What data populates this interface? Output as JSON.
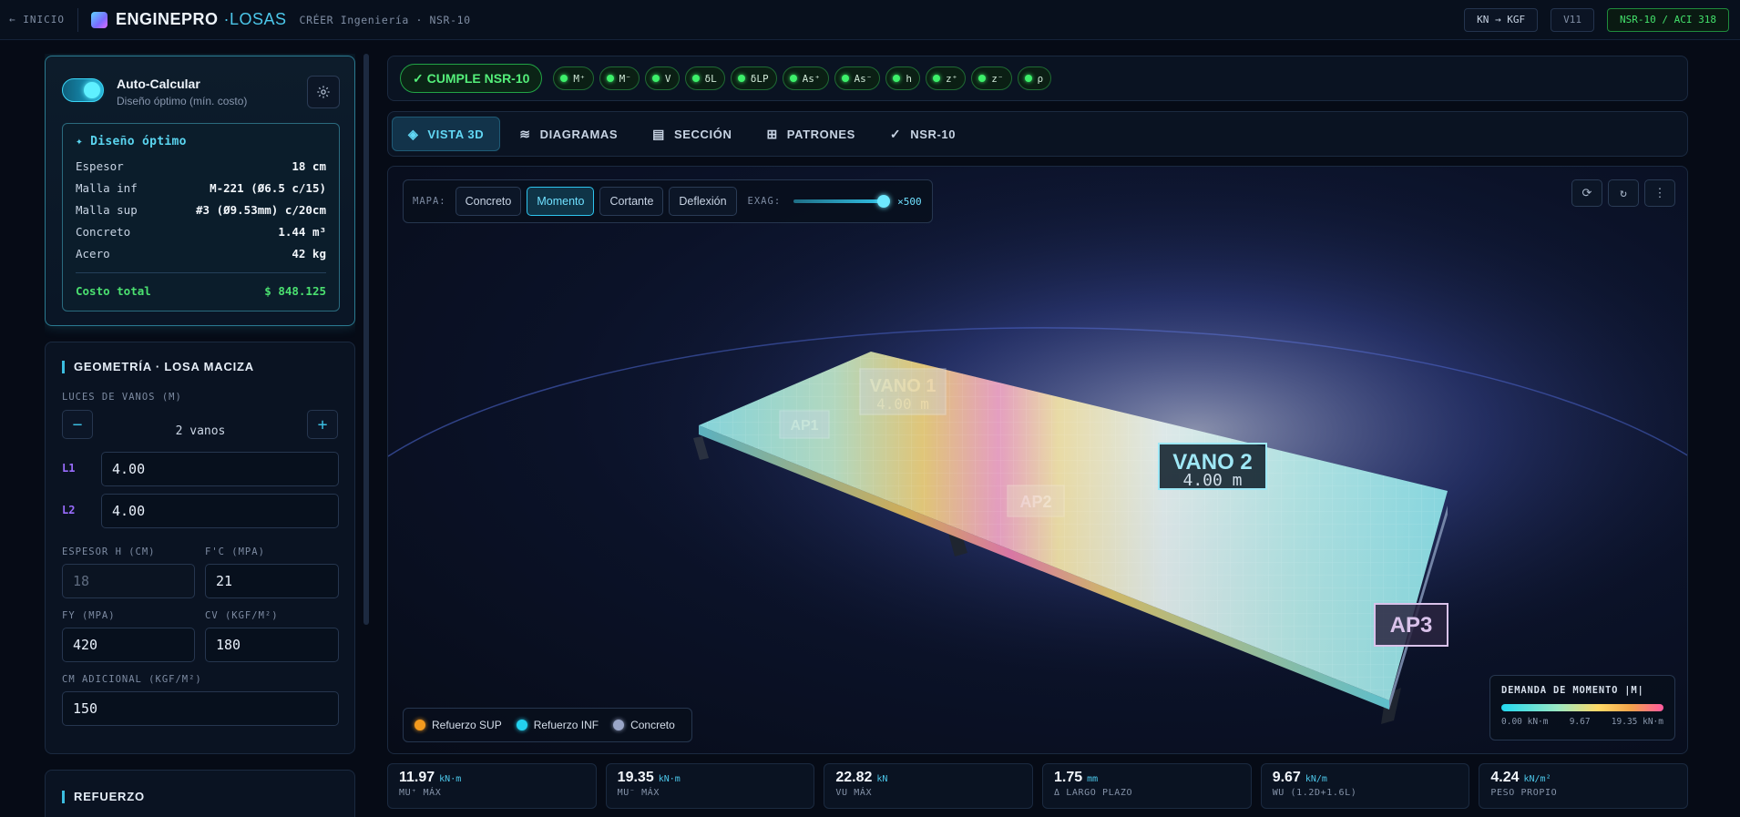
{
  "topbar": {
    "back_label": "← INICIO",
    "brand": "ENGINEPRO",
    "brand_accent": "·LOSAS",
    "subtitle": "CRÉER Ingeniería · NSR-10",
    "units_btn": "KN → KGF",
    "version": "V11",
    "norm": "NSR-10 / ACI 318"
  },
  "auto": {
    "title": "Auto-Calcular",
    "subtitle": "Diseño óptimo (mín. costo)",
    "enabled": true
  },
  "optimal": {
    "title": "Diseño óptimo",
    "rows": [
      {
        "label": "Espesor",
        "value": "18 cm"
      },
      {
        "label": "Malla inf",
        "value": "M-221 (Ø6.5 c/15)"
      },
      {
        "label": "Malla sup",
        "value": "#3 (Ø9.53mm) c/20cm"
      },
      {
        "label": "Concreto",
        "value": "1.44 m³"
      },
      {
        "label": "Acero",
        "value": "42 kg"
      }
    ],
    "total_label": "Costo total",
    "total_value": "$ 848.125"
  },
  "geometry": {
    "title": "GEOMETRÍA · LOSA MACIZA",
    "spans_label": "LUCES DE VANOS (M)",
    "spans_count": "2 vanos",
    "spans": [
      {
        "tag": "L1",
        "value": "4.00"
      },
      {
        "tag": "L2",
        "value": "4.00"
      }
    ],
    "thickness_label": "ESPESOR H (CM)",
    "thickness_placeholder": "18",
    "fc_label": "F'C (MPA)",
    "fc_value": "21",
    "fy_label": "FY (MPA)",
    "fy_value": "420",
    "cv_label": "CV (KGF/M²)",
    "cv_value": "180",
    "cm_label": "CM ADICIONAL (KGF/M²)",
    "cm_value": "150"
  },
  "refuerzo": {
    "title": "REFUERZO"
  },
  "status": {
    "badge": "✓ CUMPLE NSR-10",
    "checks": [
      "M⁺",
      "M⁻",
      "V",
      "δL",
      "δLP",
      "As⁺",
      "As⁻",
      "h",
      "z⁺",
      "z⁻",
      "ρ"
    ]
  },
  "tabs": [
    {
      "icon": "◈",
      "label": "VISTA 3D",
      "active": true
    },
    {
      "icon": "≋",
      "label": "DIAGRAMAS",
      "active": false
    },
    {
      "icon": "▤",
      "label": "SECCIÓN",
      "active": false
    },
    {
      "icon": "⊞",
      "label": "PATRONES",
      "active": false
    },
    {
      "icon": "✓",
      "label": "NSR-10",
      "active": false
    }
  ],
  "map": {
    "label": "MAPA:",
    "options": [
      "Concreto",
      "Momento",
      "Cortante",
      "Deflexión"
    ],
    "active": "Momento",
    "exag_label": "EXAG:",
    "exag_value": "×500",
    "exag_level": 1.0
  },
  "scene_labels": {
    "vano1": "VANO 1",
    "vano1_len": "4.00 m",
    "vano2": "VANO 2",
    "vano2_len": "4.00 m",
    "ap1": "AP1",
    "ap2": "AP2",
    "ap3": "AP3"
  },
  "legend": [
    {
      "label": "Refuerzo SUP",
      "color": "#f39a1e"
    },
    {
      "label": "Refuerzo INF",
      "color": "#23d2f0"
    },
    {
      "label": "Concreto",
      "color": "#9aa6c8"
    }
  ],
  "demand": {
    "title": "DEMANDA DE MOMENTO |M|",
    "min": "0.00 kN·m",
    "mid": "9.67",
    "max": "19.35 kN·m"
  },
  "stats": [
    {
      "value": "11.97",
      "unit": "kN·m",
      "label": "MU⁺ MÁX"
    },
    {
      "value": "19.35",
      "unit": "kN·m",
      "label": "MU⁻ MÁX"
    },
    {
      "value": "22.82",
      "unit": "kN",
      "label": "VU MÁX"
    },
    {
      "value": "1.75",
      "unit": "mm",
      "label": "Δ LARGO PLAZO"
    },
    {
      "value": "9.67",
      "unit": "kN/m",
      "label": "WU (1.2D+1.6L)"
    },
    {
      "value": "4.24",
      "unit": "kN/m²",
      "label": "PESO PROPIO"
    }
  ]
}
